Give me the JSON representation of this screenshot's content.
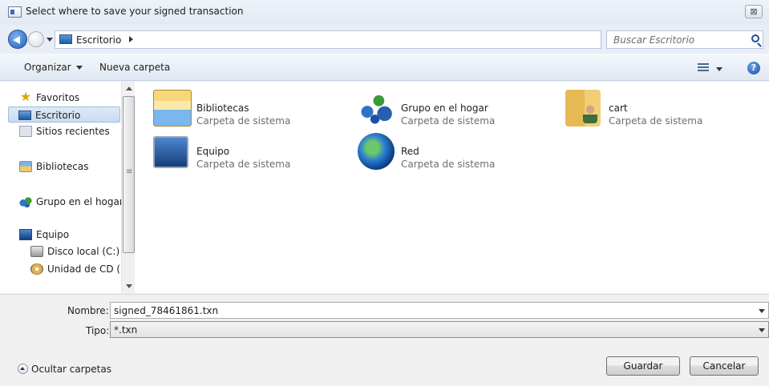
{
  "window": {
    "title": "Select where to save your signed transaction",
    "close_label": "⊠"
  },
  "address": {
    "location": "Escritorio",
    "search_placeholder": "Buscar Escritorio"
  },
  "toolbar": {
    "organize_label": "Organizar",
    "new_folder_label": "Nueva carpeta",
    "help_label": "?"
  },
  "nav": {
    "items": [
      {
        "label": "Favoritos",
        "icon": "star-icon"
      },
      {
        "label": "Escritorio",
        "icon": "desktop-icon",
        "selected": true
      },
      {
        "label": "Sitios recientes",
        "icon": "recent-places-icon"
      },
      {
        "label": "Bibliotecas",
        "icon": "libraries-icon"
      },
      {
        "label": "Grupo en el hogar",
        "icon": "homegroup-icon"
      },
      {
        "label": "Equipo",
        "icon": "computer-icon"
      },
      {
        "label": "Disco local (C:)",
        "icon": "local-disk-icon"
      },
      {
        "label": "Unidad de CD (D:",
        "icon": "cd-drive-icon"
      }
    ]
  },
  "files": [
    {
      "name": "Bibliotecas",
      "type": "Carpeta de sistema",
      "icon": "libraries-icon"
    },
    {
      "name": "Grupo en el hogar",
      "type": "Carpeta de sistema",
      "icon": "homegroup-icon"
    },
    {
      "name": "cart",
      "type": "Carpeta de sistema",
      "icon": "user-folder-icon"
    },
    {
      "name": "Equipo",
      "type": "Carpeta de sistema",
      "icon": "computer-icon"
    },
    {
      "name": "Red",
      "type": "Carpeta de sistema",
      "icon": "network-icon"
    }
  ],
  "form": {
    "filename_label": "Nombre:",
    "filename_value": "signed_78461861.txn",
    "filetype_label": "Tipo:",
    "filetype_value": "*.txn"
  },
  "footer": {
    "toggle_folders_label": "Ocultar carpetas",
    "save_label": "Guardar",
    "cancel_label": "Cancelar"
  }
}
